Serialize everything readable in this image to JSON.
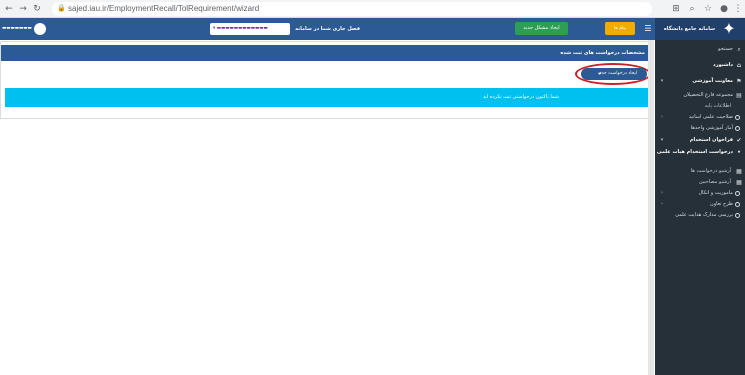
{
  "browser": {
    "url": "sajed.iau.ir/EmploymentRecall/TolRequirement/wizard",
    "back_icon": "arrow-left",
    "forward_icon": "arrow-right",
    "reload_icon": "reload"
  },
  "topbar": {
    "brand": "سامانه جامع دانشگاه آزاد اسلامی",
    "orange_button": "پیام ها",
    "green_button": "ایجاد مشکل جدید",
    "term_label": "فصل جاری شما در سامانه :",
    "term_value": "▾"
  },
  "sidebar": {
    "items": [
      {
        "label": "جستجو",
        "icon": "search-icon"
      },
      {
        "label": "داشبورد",
        "icon": "home-icon"
      },
      {
        "label": "معاونت آموزشی",
        "icon": "flag-icon"
      },
      {
        "label": "مجموعه فارغ التحصیلان",
        "icon": "trash-icon"
      },
      {
        "label": "اطلاعات پایه",
        "icon": "circle-icon"
      },
      {
        "label": "صلاحیت علمی اساتید",
        "icon": "circle-icon"
      },
      {
        "label": "آمار آموزشی واحدها",
        "icon": "circle-icon"
      },
      {
        "label": "فراخوان استخدام",
        "icon": "check-icon"
      },
      {
        "label": "درخواست استخدام هیات علمی",
        "icon": "dot-icon"
      },
      {
        "label": "آرشیو درخواست ها",
        "icon": "list-icon"
      },
      {
        "label": "آرشیو مصاحبین",
        "icon": "list-icon"
      },
      {
        "label": "ماموریت و اتکال",
        "icon": "circle-icon"
      },
      {
        "label": "طرح تعاون",
        "icon": "circle-icon"
      },
      {
        "label": "بررسی مدارک هدایت علمی",
        "icon": "circle-icon"
      }
    ]
  },
  "main": {
    "panel_title": "مشخصات درخواست های ثبت شده",
    "new_request_button": "ایجاد درخواست جدید",
    "info_message": "شما تاکنون درخواستی ثبت نکرده اید"
  }
}
